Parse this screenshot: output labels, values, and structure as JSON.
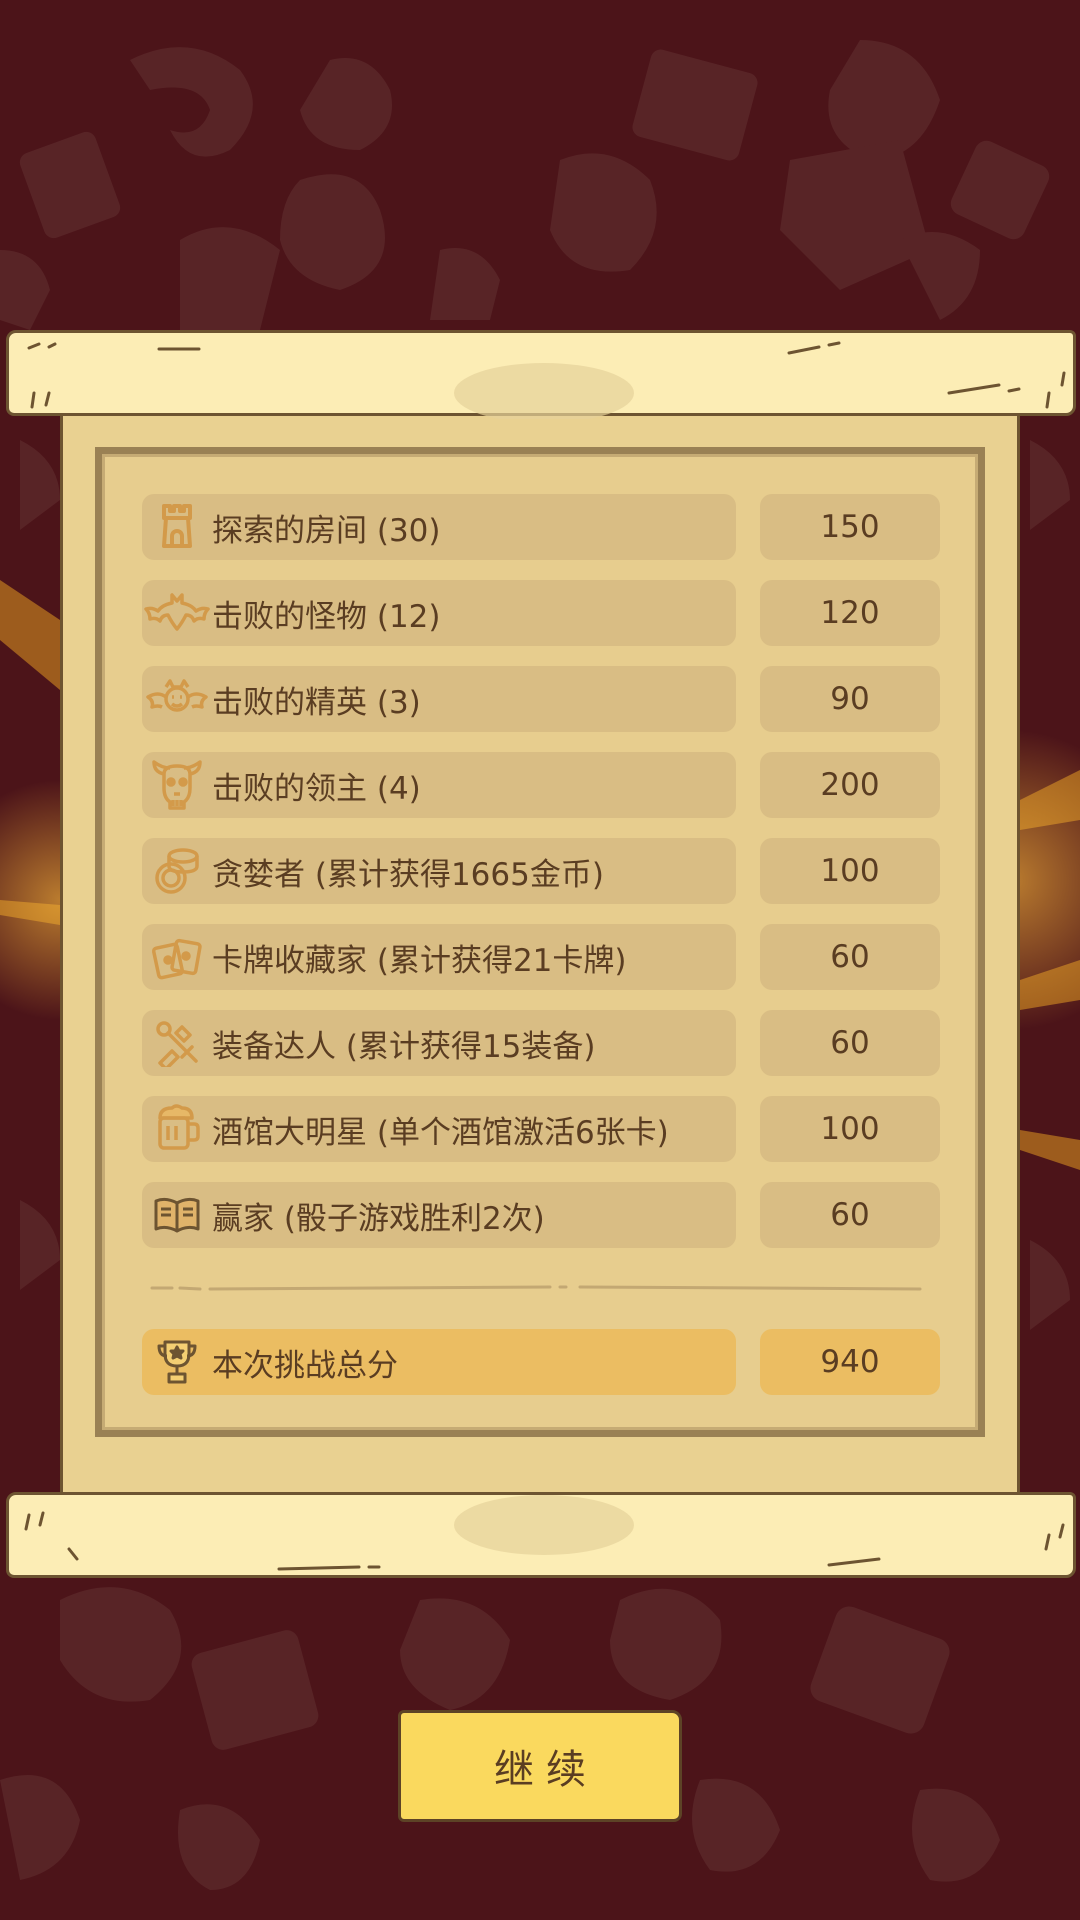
{
  "colors": {
    "background": "#4c1419",
    "parchment": "#e9d191",
    "row_fill": "#d9bd84",
    "total_fill": "#ebbd62",
    "button_fill": "#fad95e",
    "text": "#5a3d22",
    "icon": "#d39a4a"
  },
  "rows": [
    {
      "icon": "tower-icon",
      "label": "探索的房间 (30)",
      "value": "150"
    },
    {
      "icon": "bat-icon",
      "label": "击败的怪物 (12)",
      "value": "120"
    },
    {
      "icon": "winged-demon-icon",
      "label": "击败的精英 (3)",
      "value": "90"
    },
    {
      "icon": "horned-skull-icon",
      "label": "击败的领主 (4)",
      "value": "200"
    },
    {
      "icon": "coins-icon",
      "label": "贪婪者 (累计获得1665金币)",
      "value": "100"
    },
    {
      "icon": "cards-icon",
      "label": "卡牌收藏家 (累计获得21卡牌)",
      "value": "60"
    },
    {
      "icon": "equipment-icon",
      "label": "装备达人 (累计获得15装备)",
      "value": "60"
    },
    {
      "icon": "beer-mug-icon",
      "label": "酒馆大明星 (单个酒馆激活6张卡)",
      "value": "100"
    },
    {
      "icon": "book-icon",
      "label": "赢家 (骰子游戏胜利2次)",
      "value": "60"
    }
  ],
  "total": {
    "icon": "trophy-icon",
    "label": "本次挑战总分",
    "value": "940"
  },
  "continue_button": {
    "label": "继续"
  }
}
